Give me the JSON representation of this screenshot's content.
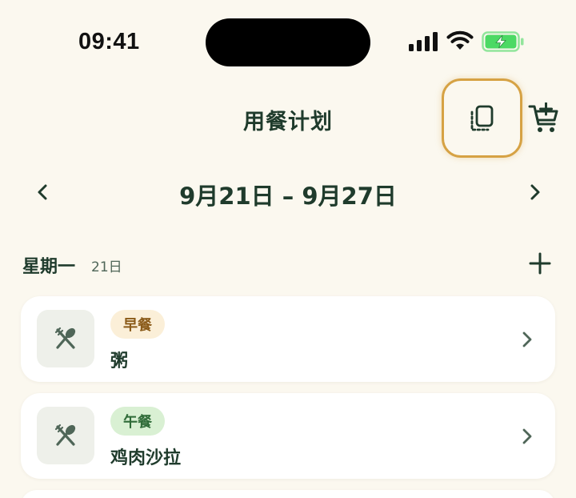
{
  "status_bar": {
    "time": "09:41",
    "icons": [
      "signal-icon",
      "wifi-icon",
      "battery-charging-icon"
    ],
    "battery_color": "#4cd964"
  },
  "header": {
    "title": "用餐计划",
    "copy_icon": "copy-icon",
    "cart_icon": "cart-add-icon",
    "highlight_color": "#d6a244"
  },
  "week": {
    "range": "9月21日 – 9月27日",
    "prev_icon": "chevron-left-icon",
    "next_icon": "chevron-right-icon"
  },
  "day": {
    "name": "星期一",
    "date": "21日",
    "add_icon": "plus-icon"
  },
  "meals": [
    {
      "tag": "早餐",
      "name": "粥",
      "icon": "utensils-icon"
    },
    {
      "tag": "午餐",
      "name": "鸡肉沙拉",
      "icon": "utensils-icon"
    }
  ],
  "colors": {
    "background": "#fbf8ef",
    "primary_text": "#1f3b2c",
    "breakfast_tag_bg": "#fbefd8",
    "lunch_tag_bg": "#d9f0d3"
  }
}
